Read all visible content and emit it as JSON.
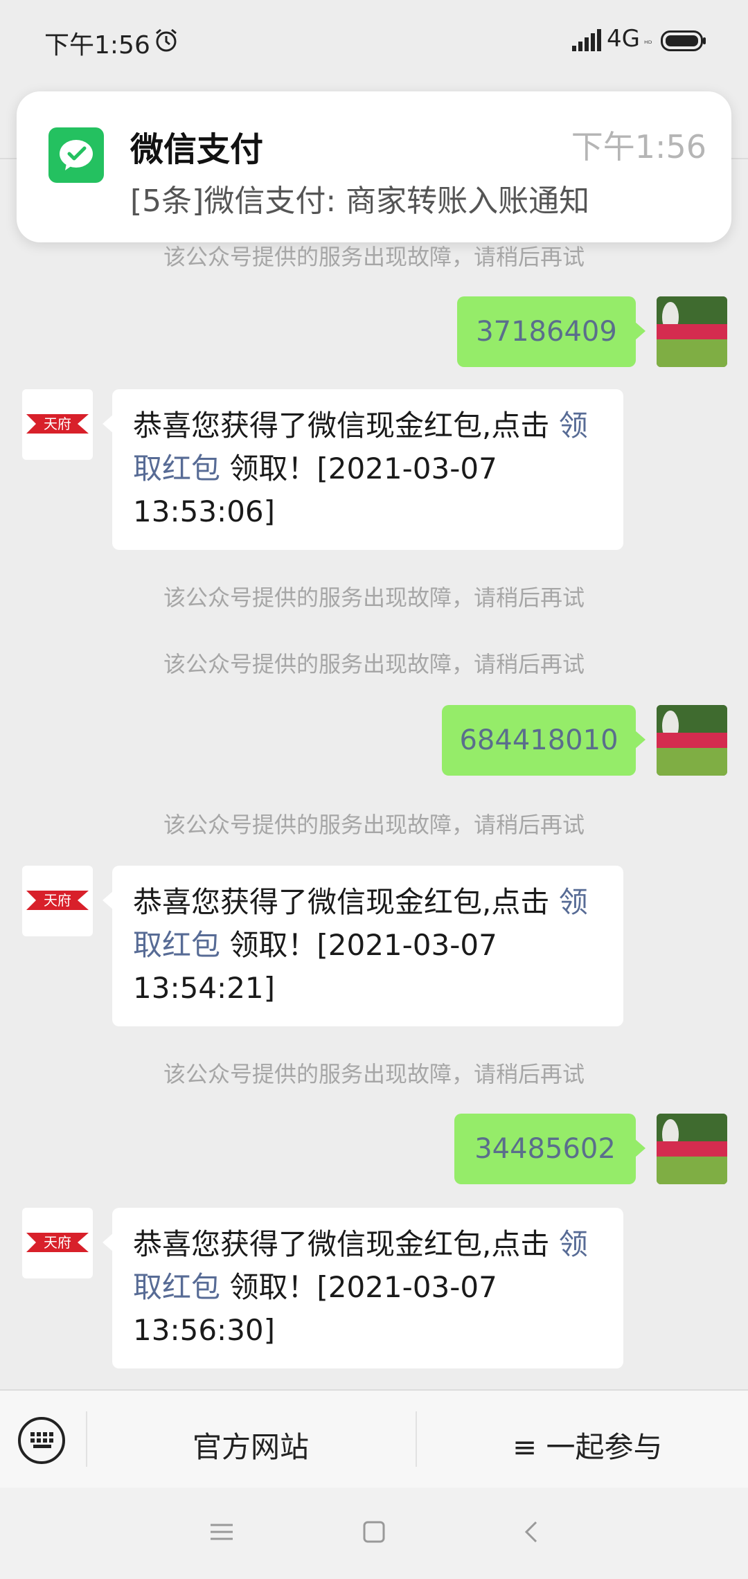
{
  "status_bar": {
    "time": "下午1:56",
    "network": "4G",
    "network_sub": "ᴴᴰ"
  },
  "notification": {
    "app": "微信支付",
    "time": "下午1:56",
    "body": "[5条]微信支付: 商家转账入账通知"
  },
  "colors": {
    "sent_bubble": "#95ec69",
    "link": "#576b95",
    "wechat_green": "#24c160"
  },
  "messages": [
    {
      "type": "system",
      "text": "该公众号提供的服务出现故障，请稍后再试"
    },
    {
      "type": "sent",
      "text": "37186409"
    },
    {
      "type": "received",
      "text_prefix": "恭喜您获得了微信现金红包,点击 ",
      "link": "领取红包",
      "text_suffix": " 领取！[2021-03-07 13:53:06]"
    },
    {
      "type": "system",
      "text": "该公众号提供的服务出现故障，请稍后再试"
    },
    {
      "type": "system",
      "text": "该公众号提供的服务出现故障，请稍后再试"
    },
    {
      "type": "sent",
      "text": "684418010"
    },
    {
      "type": "system",
      "text": "该公众号提供的服务出现故障，请稍后再试"
    },
    {
      "type": "received",
      "text_prefix": "恭喜您获得了微信现金红包,点击 ",
      "link": "领取红包",
      "text_suffix": " 领取！[2021-03-07 13:54:21]"
    },
    {
      "type": "system",
      "text": "该公众号提供的服务出现故障，请稍后再试"
    },
    {
      "type": "sent",
      "text": "34485602"
    },
    {
      "type": "received",
      "text_prefix": "恭喜您获得了微信现金红包,点击 ",
      "link": "领取红包",
      "text_suffix": " 领取！[2021-03-07 13:56:30]"
    }
  ],
  "bottom_menu": {
    "item1": "官方网站",
    "item2": "≡ 一起参与"
  },
  "icons": {
    "alarm": "alarm-icon",
    "signal": "signal-icon",
    "battery": "battery-icon",
    "notif_app": "wechat-pay-icon",
    "keyboard": "keyboard-icon",
    "nav_menu": "menu-icon",
    "nav_home": "home-icon",
    "nav_back": "back-icon"
  }
}
